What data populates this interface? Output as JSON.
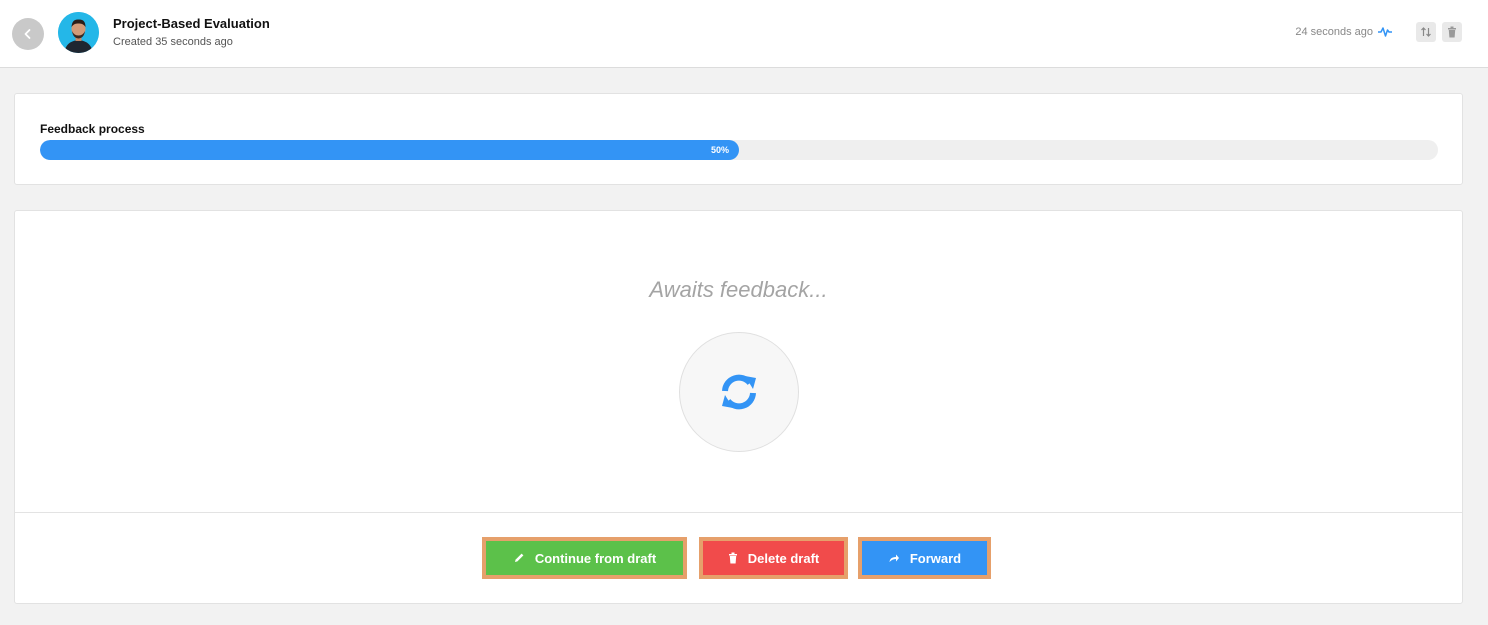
{
  "header": {
    "title": "Project-Based Evaluation",
    "subtitle": "Created 35 seconds ago",
    "activity_time": "24 seconds ago"
  },
  "icons": {
    "back": "chevron-left-icon",
    "activity": "pulse-icon",
    "sort": "sort-arrows-icon",
    "trash": "trash-icon",
    "refresh": "refresh-icon",
    "pencil": "pencil-icon",
    "forward": "forward-arrow-icon"
  },
  "progress": {
    "label": "Feedback process",
    "value": 50,
    "value_label": "50%"
  },
  "main": {
    "status_text": "Awaits feedback..."
  },
  "actions": {
    "continue_label": "Continue from draft",
    "delete_label": "Delete draft",
    "forward_label": "Forward"
  },
  "colors": {
    "accent": "#3394f5",
    "continue": "#5cc14a",
    "delete": "#f14b4b",
    "highlight": "#e6a06b"
  }
}
